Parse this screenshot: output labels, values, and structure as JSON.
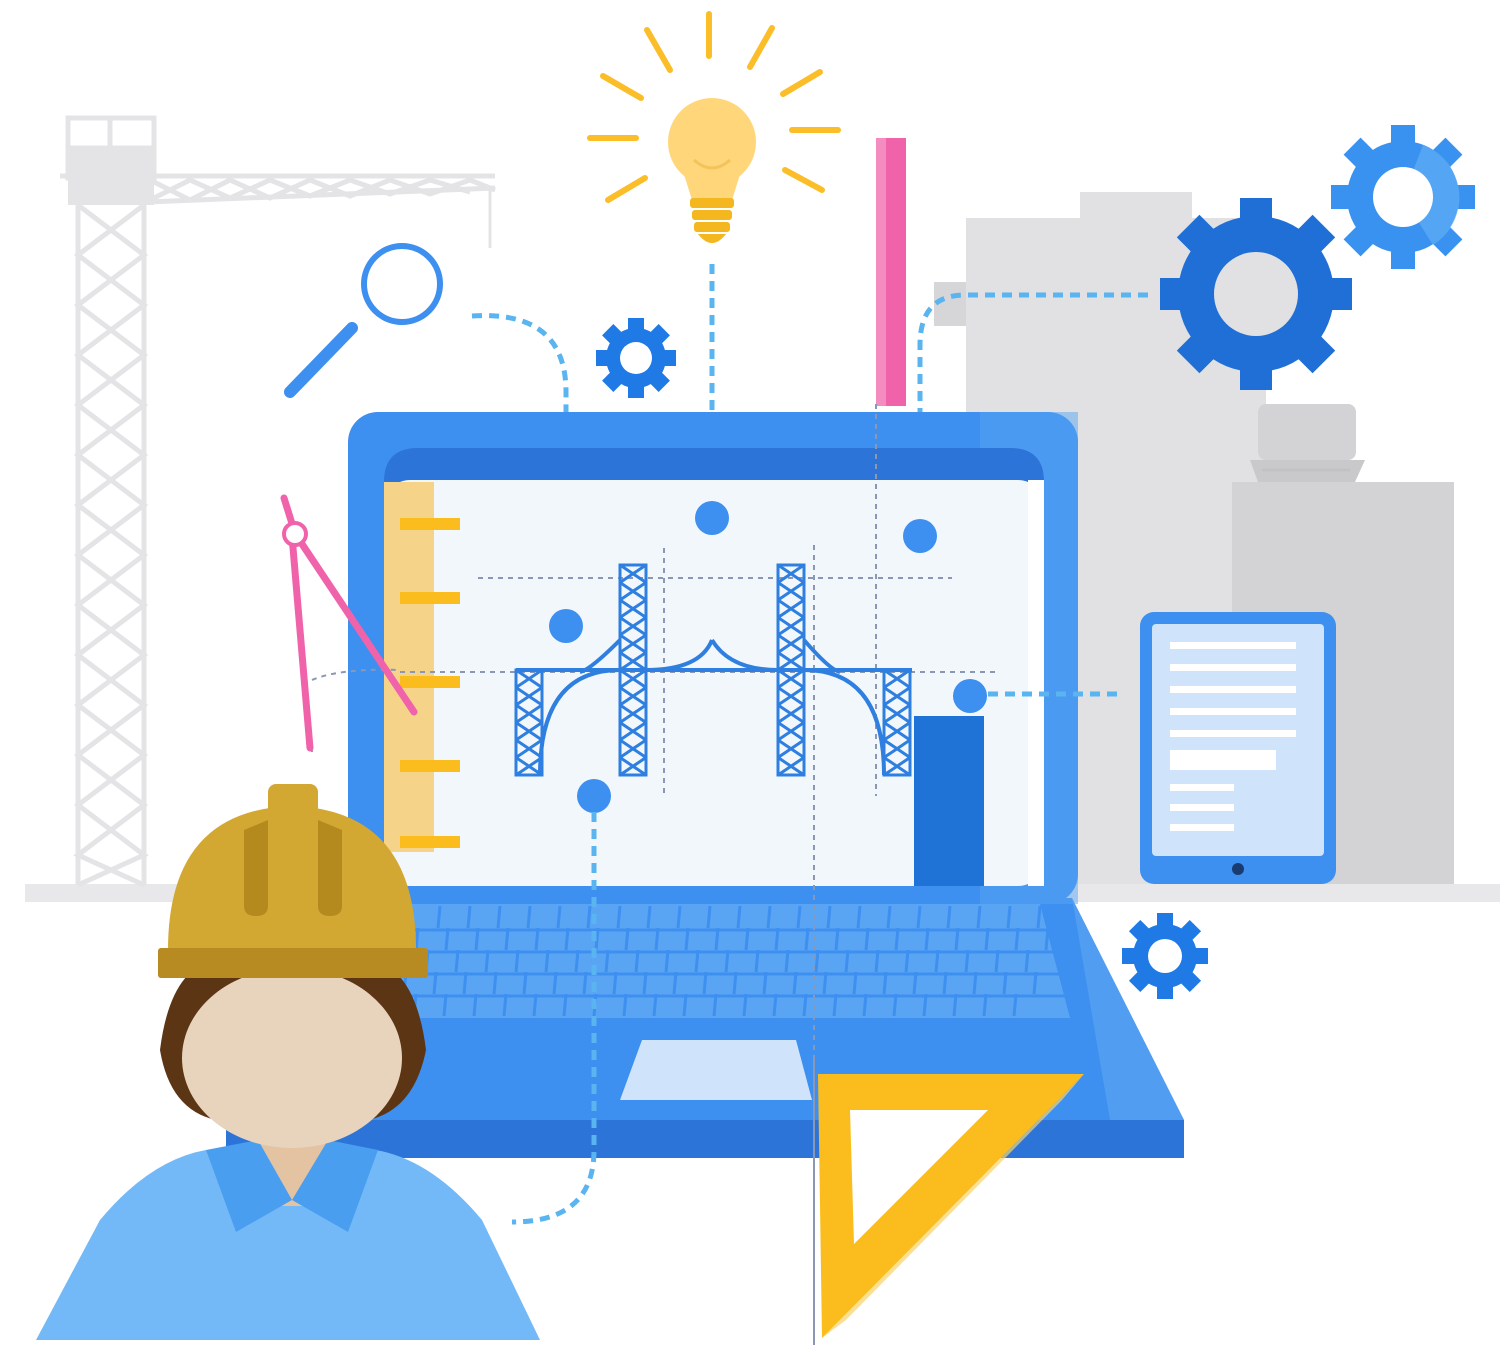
{
  "colors": {
    "background": "#ffffff",
    "building_gray": "#e1e1e3",
    "building_dark": "#d3d3d6",
    "crane_gray": "#e4e4e6",
    "laptop_blue": "#3d8ff0",
    "laptop_dark": "#2c74d8",
    "screen_bg": "#f2f7fc",
    "bridge_blue": "#2f7fe0",
    "dot_line_blue": "#5ab4f0",
    "gear_dark": "#1f6fd6",
    "gear_light": "#58a9f5",
    "bulb_yellow": "#ffd77a",
    "rays_yellow": "#fbbd28",
    "ruler_pink": "#f063aa",
    "ruler_yellow": "#f5d48a",
    "helmet_gold": "#d3a832",
    "hair_brown": "#5c3515",
    "skin": "#e8d4bd",
    "shirt_blue": "#74b9f7",
    "triangle_yellow": "#fbbd1e",
    "tablet_screen": "#cfe4fa"
  },
  "icons": [
    "tower-crane-icon",
    "lightbulb-icon",
    "magnifier-icon",
    "gear-icon",
    "laptop-icon",
    "bridge-blueprint-icon",
    "ruler-icon",
    "drafting-compass-icon",
    "tablet-icon",
    "set-square-icon",
    "engineer-avatar-icon",
    "hard-hat-icon"
  ]
}
